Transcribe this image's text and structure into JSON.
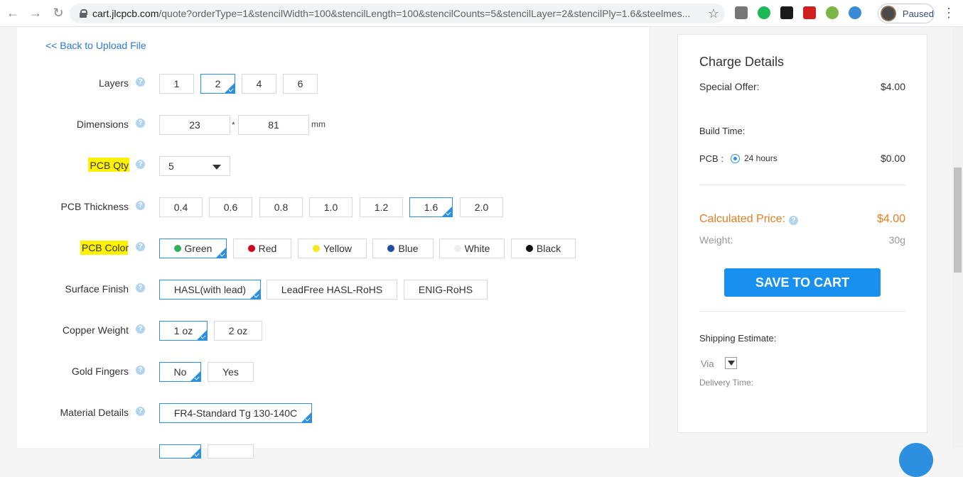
{
  "browser": {
    "url_host": "cart.jlcpcb.com",
    "url_rest": "/quote?orderType=1&stencilWidth=100&stencilLength=100&stencilCounts=5&stencilLayer=2&stencilPly=1.6&steelmes...",
    "profile_label": "Paused"
  },
  "main": {
    "back_link": "<< Back to Upload File",
    "help_glyph": "?",
    "layers": {
      "label": "Layers",
      "options": [
        "1",
        "2",
        "4",
        "6"
      ],
      "selected": "2"
    },
    "dimensions": {
      "label": "Dimensions",
      "width": "23",
      "sep": "*",
      "length": "81",
      "unit": "mm"
    },
    "qty": {
      "label": "PCB Qty",
      "value": "5"
    },
    "thickness": {
      "label": "PCB Thickness",
      "options": [
        "0.4",
        "0.6",
        "0.8",
        "1.0",
        "1.2",
        "1.6",
        "2.0"
      ],
      "selected": "1.6"
    },
    "color": {
      "label": "PCB Color",
      "options": [
        {
          "name": "Green",
          "color": "#2db35d"
        },
        {
          "name": "Red",
          "color": "#d0021b"
        },
        {
          "name": "Yellow",
          "color": "#f8e71c"
        },
        {
          "name": "Blue",
          "color": "#1f4fa3"
        },
        {
          "name": "White",
          "color": "#eeeeee"
        },
        {
          "name": "Black",
          "color": "#111111"
        }
      ],
      "selected": "Green"
    },
    "surface": {
      "label": "Surface Finish",
      "options": [
        "HASL(with lead)",
        "LeadFree HASL-RoHS",
        "ENIG-RoHS"
      ],
      "selected": "HASL(with lead)"
    },
    "copper": {
      "label": "Copper Weight",
      "options": [
        "1 oz",
        "2 oz"
      ],
      "selected": "1 oz"
    },
    "gold": {
      "label": "Gold Fingers",
      "options": [
        "No",
        "Yes"
      ],
      "selected": "No"
    },
    "material": {
      "label": "Material Details",
      "value": "FR4-Standard Tg 130-140C"
    }
  },
  "charges": {
    "title": "Charge Details",
    "special_offer_label": "Special Offer:",
    "special_offer_value": "$4.00",
    "build_time_label": "Build Time:",
    "pcb_label": "PCB :",
    "pcb_time": "24 hours",
    "pcb_cost": "$0.00",
    "calc_label": "Calculated Price:",
    "calc_value": "$4.00",
    "weight_label": "Weight:",
    "weight_value": "30g",
    "cart_button": "SAVE TO CART",
    "shipping_label": "Shipping Estimate:",
    "via_label": "Via",
    "delivery_label": "Delivery Time:",
    "accent": "#e67e22",
    "button_color": "#1890f0"
  }
}
